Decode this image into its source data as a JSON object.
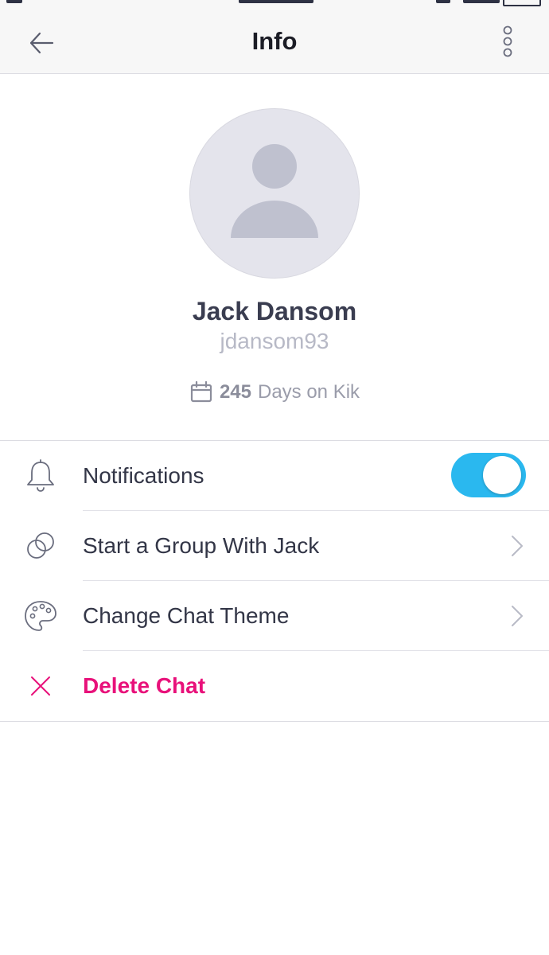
{
  "header": {
    "title": "Info",
    "back_icon": "arrow-left-icon",
    "more_icon": "vertical-dots-icon"
  },
  "profile": {
    "avatar_icon": "default-avatar-icon",
    "name": "Jack Dansom",
    "username": "jdansom93",
    "days_icon": "calendar-icon",
    "days_count": "245",
    "days_text": "Days on Kik"
  },
  "options": [
    {
      "label": "Notifications",
      "icon": "bell-icon",
      "control": "toggle",
      "enabled": true
    },
    {
      "label": "Start a Group With Jack",
      "icon": "group-circles-icon",
      "control": "chevron"
    },
    {
      "label": "Change Chat Theme",
      "icon": "palette-icon",
      "control": "chevron"
    },
    {
      "label": "Delete Chat",
      "icon": "close-icon",
      "control": "none",
      "style": "danger"
    }
  ],
  "colors": {
    "accent": "#2ab8ef",
    "danger": "#e8117a",
    "avatar_bg": "#e4e4ec",
    "avatar_fg": "#bfc1cf",
    "text": "#333647",
    "muted": "#b7b9c6"
  }
}
